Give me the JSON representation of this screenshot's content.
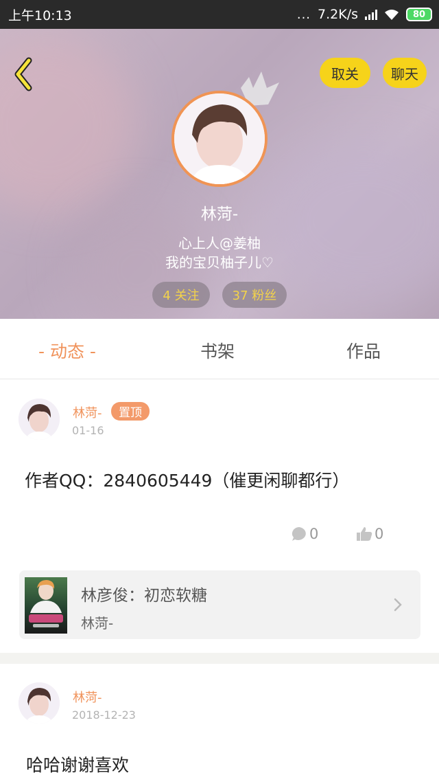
{
  "status_bar": {
    "time": "上午10:13",
    "dots": "...",
    "network_speed": "7.2K/s",
    "battery": "80"
  },
  "profile": {
    "unfollow_label": "取关",
    "chat_label": "聊天",
    "name": "林菏-",
    "bio_line1": "心上人@姜柚",
    "bio_line2": "我的宝贝柚子儿♡",
    "follows": "4 关注",
    "fans": "37 粉丝"
  },
  "tabs": [
    {
      "label": "- 动态 -",
      "active": true
    },
    {
      "label": "书架",
      "active": false
    },
    {
      "label": "作品",
      "active": false
    }
  ],
  "posts": [
    {
      "author": "林菏-",
      "badge": "置顶",
      "date": "01-16",
      "text": "作者QQ：2840605449（催更闲聊都行）",
      "comments": "0",
      "likes": "0",
      "book": {
        "title": "林彦俊：初恋软糖",
        "author": "林菏-"
      }
    },
    {
      "author": "林菏-",
      "date": "2018-12-23",
      "text": "哈哈谢谢喜欢"
    }
  ],
  "colors": {
    "accent": "#f0925a",
    "yellow_button": "#f6d31a",
    "stat_text": "#f3d34a"
  },
  "icons": [
    "back-arrow-icon",
    "crown-icon",
    "comment-icon",
    "thumbs-up-icon",
    "chevron-right-icon",
    "wifi-icon",
    "signal-icon",
    "battery-icon"
  ]
}
